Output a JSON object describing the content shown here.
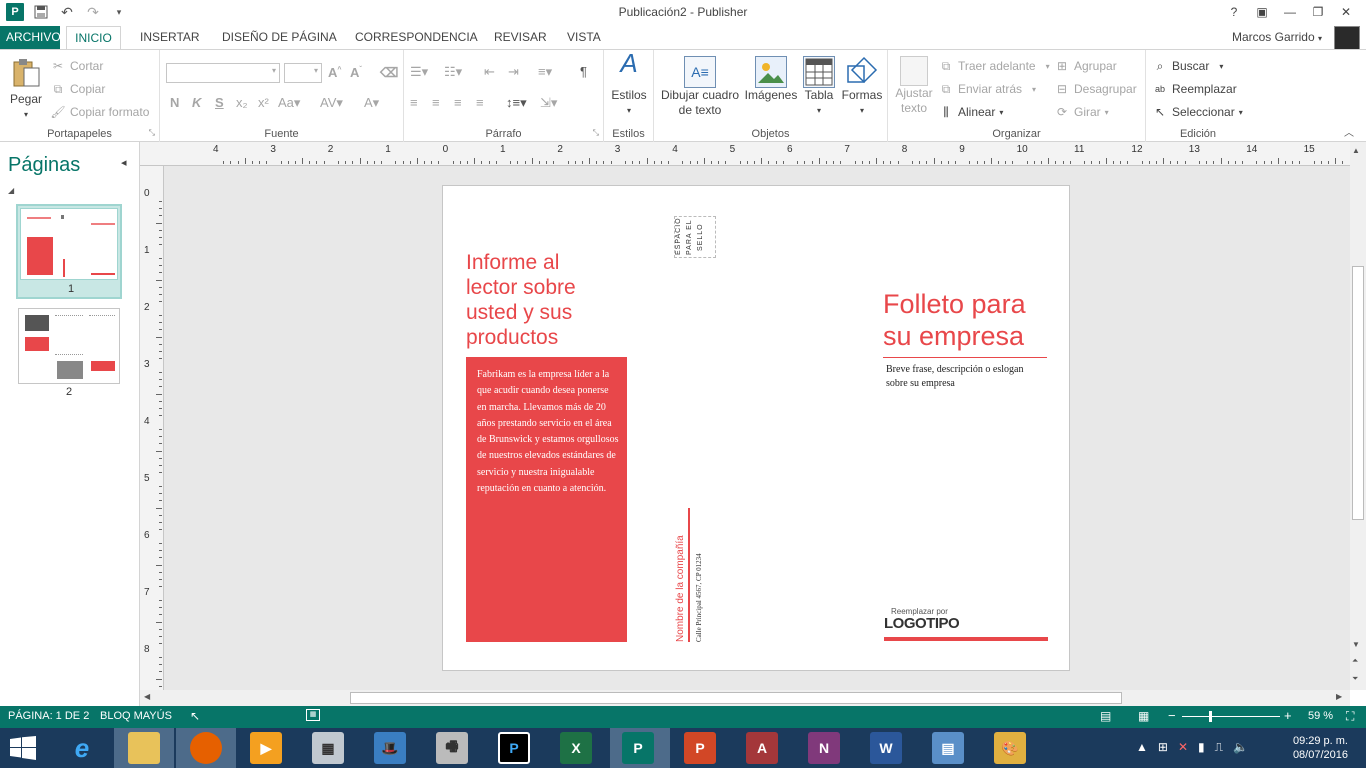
{
  "window": {
    "title": "Publicación2 - Publisher",
    "user": "Marcos Garrido"
  },
  "tabs": [
    {
      "label": "ARCHIVO"
    },
    {
      "label": "INICIO"
    },
    {
      "label": "INSERTAR"
    },
    {
      "label": "DISEÑO DE PÁGINA"
    },
    {
      "label": "CORRESPONDENCIA"
    },
    {
      "label": "REVISAR"
    },
    {
      "label": "VISTA"
    }
  ],
  "ribbon": {
    "portapapeles": {
      "label": "Portapapeles",
      "paste": "Pegar",
      "cut": "Cortar",
      "copy": "Copiar",
      "format_painter": "Copiar formato"
    },
    "fuente": {
      "label": "Fuente"
    },
    "parrafo": {
      "label": "Párrafo"
    },
    "estilos": {
      "label": "Estilos",
      "button": "Estilos"
    },
    "objetos": {
      "label": "Objetos",
      "textbox": "Dibujar cuadro de texto",
      "images": "Imágenes",
      "table": "Tabla",
      "shapes": "Formas"
    },
    "organizar": {
      "label": "Organizar",
      "wrap": "Ajustar texto",
      "bring_forward": "Traer adelante",
      "send_backward": "Enviar atrás",
      "align": "Alinear",
      "group": "Agrupar",
      "ungroup": "Desagrupar",
      "rotate": "Girar"
    },
    "edicion": {
      "label": "Edición",
      "find": "Buscar",
      "replace": "Reemplazar",
      "select": "Seleccionar"
    }
  },
  "pages_pane": {
    "title": "Páginas",
    "pages": [
      {
        "number": "1"
      },
      {
        "number": "2"
      }
    ]
  },
  "ruler": {
    "top_ticks": [
      "4",
      "3",
      "2",
      "1",
      "0",
      "1",
      "2",
      "3",
      "4",
      "5",
      "6",
      "7",
      "8",
      "9",
      "10",
      "11",
      "12",
      "13",
      "14",
      "15"
    ],
    "left_ticks": [
      "0",
      "1",
      "2",
      "3",
      "4",
      "5",
      "6",
      "7",
      "8"
    ]
  },
  "document": {
    "left_heading": "Informe al lector sobre usted y sus productos",
    "left_body": "Fabrikam es la empresa líder a la que acudir cuando desea ponerse en marcha. Llevamos más de 20 años prestando servicio en el área de Brunswick y estamos orgullosos de nuestros elevados estándares de servicio y nuestra inigualable reputación en cuanto a atención.",
    "stamp": "ESPACIO PARA EL SELLO",
    "company_name": "Nombre de la compañía",
    "address": "Calle Principal 4567, CP 01234",
    "title": "Folleto para su empresa",
    "tagline": "Breve frase, descripción o eslogan sobre su empresa",
    "logo_small": "Reemplazar por",
    "logo_big": "LOGOTIPO"
  },
  "status": {
    "page": "PÁGINA: 1 DE 2",
    "caps": "BLOQ MAYÚS",
    "zoom": "59 %",
    "zoom_level": 0.59
  },
  "taskbar": {
    "time": "09:29 p. m.",
    "date": "08/07/2016"
  },
  "colors": {
    "accent": "#077568",
    "brand_red": "#e8474a",
    "taskbar": "#1b3a5c"
  }
}
